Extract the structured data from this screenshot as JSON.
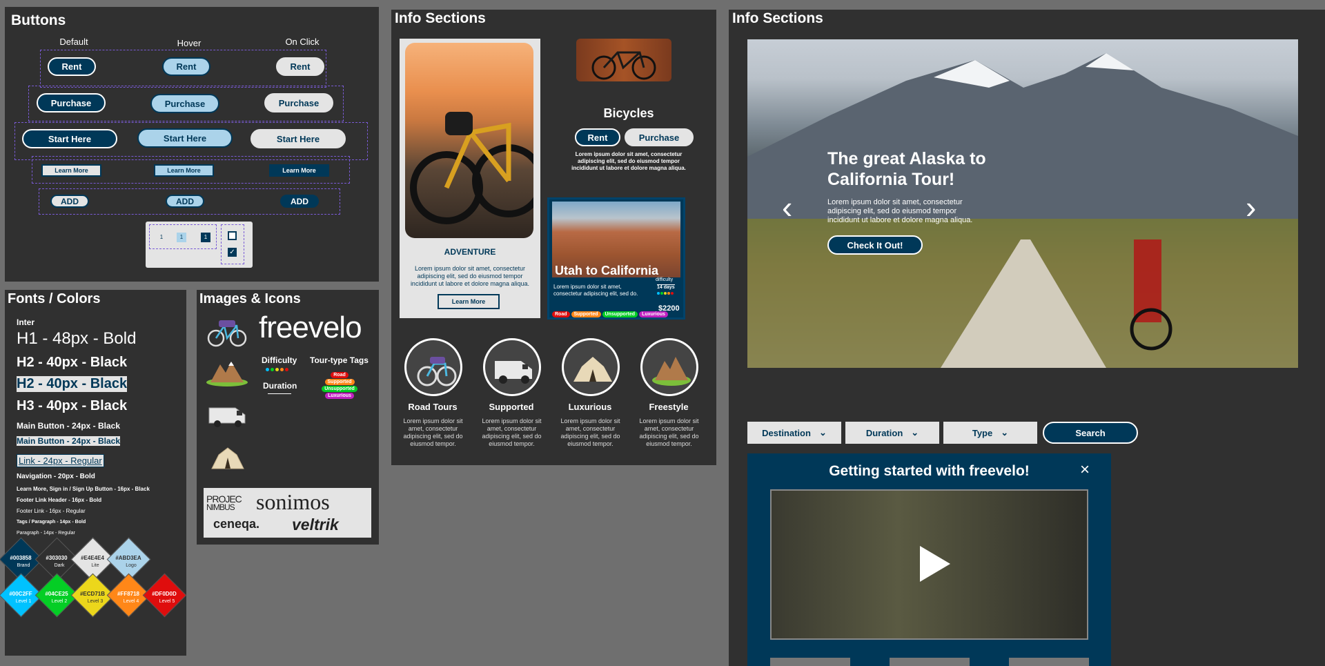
{
  "buttons_panel": {
    "title": "Buttons",
    "headers": [
      "Default",
      "Hover",
      "On Click"
    ],
    "rent": "Rent",
    "purchase": "Purchase",
    "start": "Start Here",
    "learn": "Learn More",
    "add": "ADD",
    "pager": [
      "1",
      "1",
      "1"
    ]
  },
  "fonts_panel": {
    "title": "Fonts / Colors",
    "font_name": "Inter",
    "lines": [
      "H1 - 48px - Bold",
      "H2 - 40px - Black",
      "H2 - 40px - Black",
      "H3 - 40px - Black",
      "Main Button -  24px - Black",
      "Main Button -  24px - Black",
      "Link - 24px - Regular",
      "Navigation - 20px - Bold",
      "Learn More, Sign in / Sign Up Button - 16px - Black",
      "Footer Link Header - 16px - Bold",
      "Footer Link - 16px - Regular",
      "Tags / Paragraph - 14px - Bold",
      "Paragraph - 14px - Regular"
    ],
    "swatches": [
      {
        "hex": "#003858",
        "label": "Brand",
        "color": "#003858"
      },
      {
        "hex": "#303030",
        "label": "Dark",
        "color": "#303030"
      },
      {
        "hex": "#E4E4E4",
        "label": "Lite",
        "color": "#E4E4E4"
      },
      {
        "hex": "#ABD3EA",
        "label": "Logo",
        "color": "#ABD3EA"
      },
      {
        "hex": "#00C2FF",
        "label": "Level 1",
        "color": "#00C2FF"
      },
      {
        "hex": "#04CE25",
        "label": "Level 2",
        "color": "#04CE25"
      },
      {
        "hex": "#ECD71B",
        "label": "Level 3",
        "color": "#ECD71B"
      },
      {
        "hex": "#FF8718",
        "label": "Level 4",
        "color": "#FF8718"
      },
      {
        "hex": "#DF0D0D",
        "label": "Level 5",
        "color": "#DF0D0D"
      }
    ]
  },
  "images_panel": {
    "title": "Images & Icons",
    "logo": "freevelo",
    "difficulty": "Difficulty",
    "duration": "Duration",
    "tour_tags": "Tour-type Tags",
    "tags": [
      "Road",
      "Supported",
      "Unsupported",
      "Luxurious"
    ],
    "sponsors": [
      "PROJEC",
      "NIMBUS",
      "sonimos",
      "ceneqa.",
      "veltrik"
    ]
  },
  "info_mid": {
    "title": "Info Sections",
    "adventure": "ADVENTURE",
    "adv_text": "Lorem ipsum dolor sit amet, consectetur adipiscing elit, sed do eiusmod tempor incididunt ut labore et dolore magna aliqua.",
    "learn": "Learn More",
    "bicycles": "Bicycles",
    "rent": "Rent",
    "purchase": "Purchase",
    "bike_text": "Lorem ipsum dolor sit amet, consectetur adipiscing elit, sed do eiusmod tempor incididunt ut labore et dolore magna aliqua.",
    "utah": "Utah to California",
    "utah_text": "Lorem ipsum dolor sit amet, consectetur adipiscing elit, sed do.",
    "days": "14 days",
    "difficulty": "difficulty",
    "tags": [
      "Road",
      "Supported",
      "Unsupported",
      "Luxurious"
    ],
    "price": "$2200",
    "categories": [
      {
        "title": "Road Tours",
        "text": "Lorem ipsum dolor sit amet, consectetur adipiscing elit, sed do eiusmod tempor."
      },
      {
        "title": "Supported",
        "text": "Lorem ipsum dolor sit amet, consectetur adipiscing elit, sed do eiusmod tempor."
      },
      {
        "title": "Luxurious",
        "text": "Lorem ipsum dolor sit amet, consectetur adipiscing elit, sed do eiusmod tempor."
      },
      {
        "title": "Freestyle",
        "text": "Lorem ipsum dolor sit amet, consectetur adipiscing elit, sed do eiusmod tempor."
      }
    ]
  },
  "info_right": {
    "title": "Info Sections",
    "hero_title": "The great Alaska to California Tour!",
    "hero_text": "Lorem ipsum dolor sit amet, consectetur adipiscing elit, sed do eiusmod tempor incididunt ut labore et dolore magna aliqua.",
    "cta": "Check It Out!",
    "filters": [
      "Destination",
      "Duration",
      "Type"
    ],
    "search": "Search",
    "modal_title": "Getting started with freevelo!"
  }
}
